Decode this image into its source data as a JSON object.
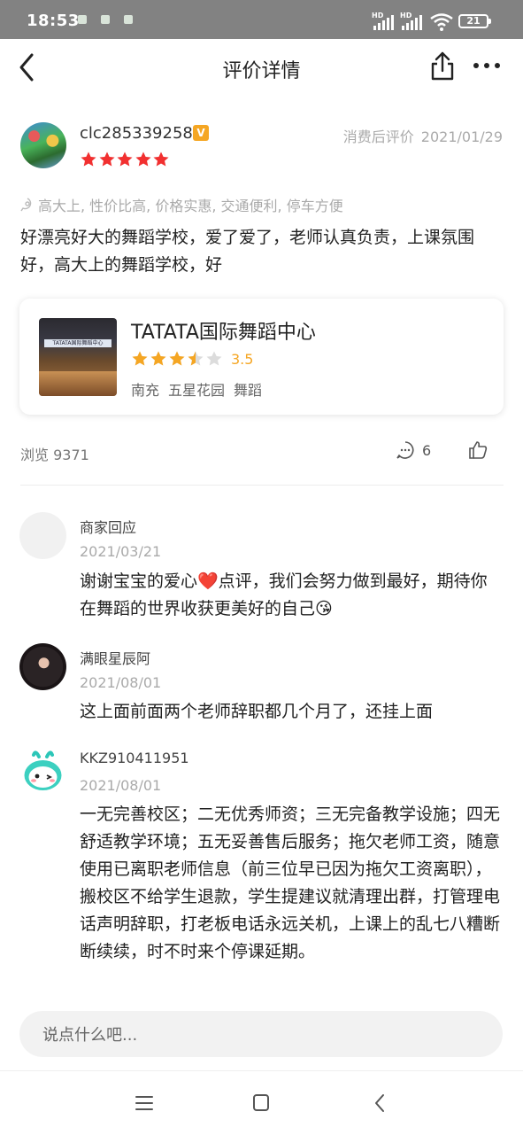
{
  "status_bar": {
    "time": "18:53",
    "battery": "21",
    "hd1": "HD",
    "hd2": "HD"
  },
  "header": {
    "title": "评价详情",
    "icons": [
      "back-arrow-icon",
      "share-icon",
      "more-icon"
    ]
  },
  "review": {
    "username": "clc285339258",
    "badge": "V",
    "meta_label": "消费后评价",
    "date": "2021/01/29",
    "star_count": 5,
    "tags": "高大上, 性价比高, 价格实惠, 交通便利, 停车方便",
    "text": "好漂亮好大的舞蹈学校，爱了爱了，老师认真负责，上课氛围好，高大上的舞蹈学校，好"
  },
  "shop": {
    "name": "TATATA国际舞蹈中心",
    "image_sign": "TATATA国际舞蹈中心",
    "rating": "3.5",
    "rating_value": 3.5,
    "area": "南充",
    "district": "五星花园",
    "category": "舞蹈"
  },
  "stats": {
    "views_label": "浏览",
    "views": "9371",
    "comments": "6"
  },
  "comments": [
    {
      "name": "商家回应",
      "date": "2021/03/21",
      "text": "谢谢宝宝的爱心❤️点评，我们会努力做到最好，期待你在舞蹈的世界收获更美好的自己😘"
    },
    {
      "name": "满眼星辰阿",
      "date": "2021/08/01",
      "text": "这上面前面两个老师辞职都几个月了，还挂上面"
    },
    {
      "name": "KKZ910411951",
      "date": "2021/08/01",
      "text": "一无完善校区；二无优秀师资；三无完备教学设施；四无舒适教学环境；五无妥善售后服务；拖欠老师工资，随意使用已离职老师信息（前三位早已因为拖欠工资离职），搬校区不给学生退款，学生提建议就清理出群，打管理电话声明辞职，打老板电话永远关机，上课上的乱七八糟断断续续，时不时来个停课延期。"
    }
  ],
  "input": {
    "placeholder": "说点什么吧..."
  },
  "colors": {
    "star_red": "#f23030",
    "star_gold": "#f5a623",
    "muted": "#aaaaaa",
    "badge": "#f5a623"
  }
}
